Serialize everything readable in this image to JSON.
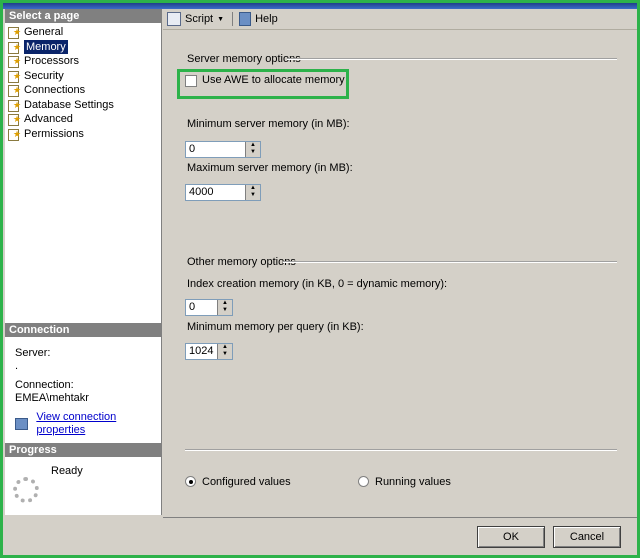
{
  "left": {
    "select_header": "Select a page",
    "pages": [
      "General",
      "Memory",
      "Processors",
      "Security",
      "Connections",
      "Database Settings",
      "Advanced",
      "Permissions"
    ],
    "selected_index": 1,
    "connection_header": "Connection",
    "server_label": "Server:",
    "server_value": ".",
    "connection_label": "Connection:",
    "connection_value": "EMEA\\mehtakr",
    "view_props_link": "View connection properties",
    "progress_header": "Progress",
    "progress_status": "Ready"
  },
  "toolbar": {
    "script_label": "Script",
    "help_label": "Help"
  },
  "server_memory": {
    "group_label": "Server memory options",
    "awe_label": "Use AWE to allocate memory",
    "awe_checked": false,
    "min_label": "Minimum server memory (in MB):",
    "min_value": "0",
    "max_label": "Maximum server memory (in MB):",
    "max_value": "4000"
  },
  "other_memory": {
    "group_label": "Other memory options",
    "index_label": "Index creation memory (in KB, 0 = dynamic memory):",
    "index_value": "0",
    "query_label": "Minimum memory per query (in KB):",
    "query_value": "1024"
  },
  "view_options": {
    "configured_label": "Configured values",
    "running_label": "Running values",
    "selected": "configured"
  },
  "buttons": {
    "ok": "OK",
    "cancel": "Cancel"
  },
  "colors": {
    "highlight": "#2db24a",
    "selected_bg": "#0a246a"
  }
}
